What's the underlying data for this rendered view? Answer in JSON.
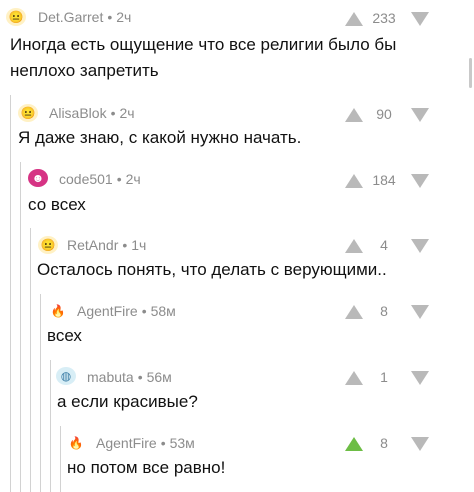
{
  "comments": [
    {
      "author": "Det.Garret",
      "time": "2ч",
      "score": "233",
      "text_lines": [
        "Иногда есть ощущение что все религии было бы",
        "неплохо запретить"
      ],
      "avatar": "face-icon"
    },
    {
      "author": "AlisaBlok",
      "time": "2ч",
      "score": "90",
      "text_lines": [
        "Я даже знаю, с какой нужно начать."
      ],
      "avatar": "face-icon"
    },
    {
      "author": "code501",
      "time": "2ч",
      "score": "184",
      "text_lines": [
        "со всех"
      ],
      "avatar": "troll-icon"
    },
    {
      "author": "RetAndr",
      "time": "1ч",
      "score": "4",
      "text_lines": [
        "Осталось понять, что делать с верующими.."
      ],
      "avatar": "face-icon"
    },
    {
      "author": "AgentFire",
      "time": "58м",
      "score": "8",
      "text_lines": [
        "всех"
      ],
      "avatar": "fire-icon"
    },
    {
      "author": "mabuta",
      "time": "56м",
      "score": "1",
      "text_lines": [
        "а если красивые?"
      ],
      "avatar": "globe-icon"
    },
    {
      "author": "AgentFire",
      "time": "53м",
      "score": "8",
      "text_lines": [
        "но потом все равно!"
      ],
      "avatar": "fire-icon",
      "upvoted": true
    }
  ],
  "colors": {
    "vote_default": "#b9b9b9",
    "vote_upvoted": "#6dbd45",
    "meta_text": "#8c8c8c",
    "thread_line": "#d2d2d2"
  }
}
